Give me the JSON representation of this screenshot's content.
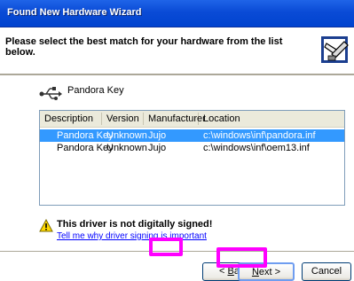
{
  "window": {
    "title": "Found New Hardware Wizard"
  },
  "header": {
    "instruction": "Please select the best match for your hardware from the list below."
  },
  "device": {
    "name": "Pandora Key"
  },
  "list": {
    "columns": [
      "Description",
      "Version",
      "Manufacturer",
      "Location"
    ],
    "rows": [
      {
        "description": "Pandora Key",
        "version": "Unknown",
        "manufacturer": "Jujo",
        "location": "c:\\windows\\inf\\pandora.inf",
        "selected": true
      },
      {
        "description": "Pandora Key",
        "version": "Unknown",
        "manufacturer": "Jujo",
        "location": "c:\\windows\\inf\\oem13.inf",
        "selected": false
      }
    ]
  },
  "warning": {
    "message": "This driver is not digitally signed!",
    "link": "Tell me why driver signing is important"
  },
  "buttons": {
    "back": {
      "accel": "B",
      "rest": "ack",
      "prefix": "< "
    },
    "next": {
      "accel": "N",
      "rest": "ext",
      "suffix": " >"
    },
    "cancel": "Cancel"
  },
  "colors": {
    "titlebar": "#0a4bd6",
    "selection": "#3399ff",
    "annotation": "#ff00ff",
    "link": "#0000ff"
  }
}
